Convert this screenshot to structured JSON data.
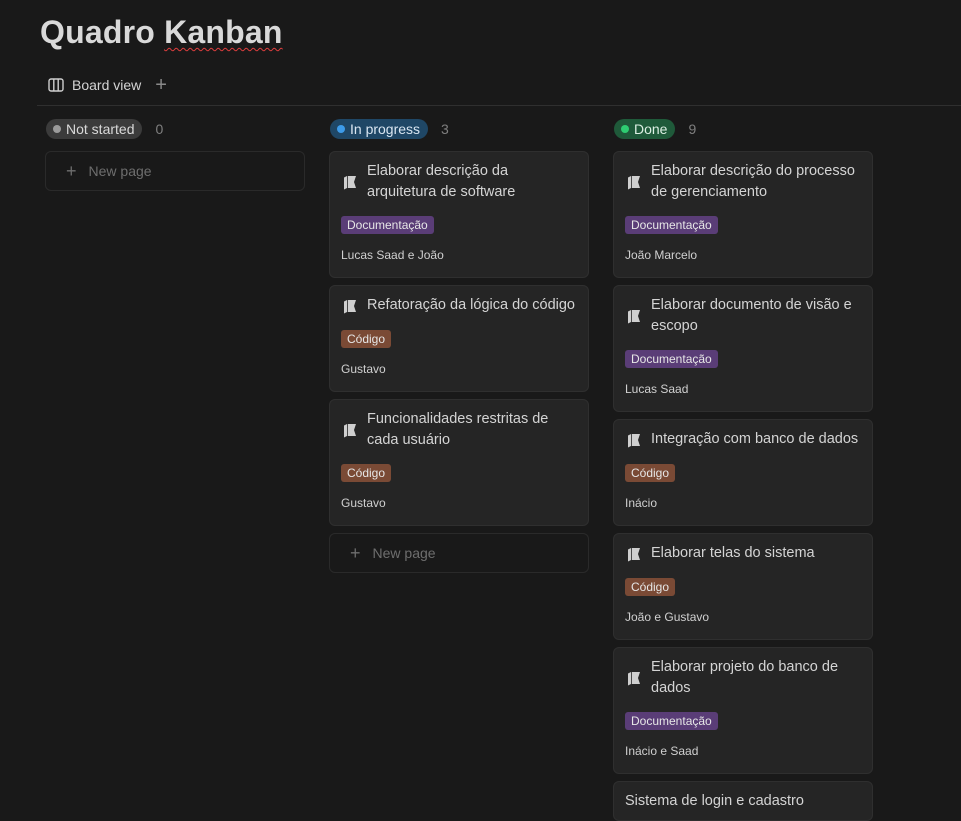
{
  "page": {
    "title_part1": "Quadro ",
    "title_part2": "Kanban"
  },
  "views": {
    "active_label": "Board view",
    "add_symbol": "+"
  },
  "colors": {
    "not_started_pill": "#3b3b3b",
    "not_started_dot": "#9b9b9b",
    "in_progress_pill": "#1f4766",
    "in_progress_dot": "#3d9be9",
    "done_pill": "#1f5a3a",
    "done_dot": "#2ecc71",
    "tag_documentacao": "#5a3d77",
    "tag_codigo": "#7a4a35"
  },
  "columns": [
    {
      "status": "Not started",
      "count": "0",
      "new_page_label": "New page",
      "cards": []
    },
    {
      "status": "In progress",
      "count": "3",
      "new_page_label": "New page",
      "cards": [
        {
          "title": "Elaborar descrição da arquitetura de software",
          "tag": "Documentação",
          "assignee": "Lucas Saad e João"
        },
        {
          "title": "Refatoração da lógica do código",
          "tag": "Código",
          "assignee": "Gustavo"
        },
        {
          "title": "Funcionalidades restritas de cada usuário",
          "tag": "Código",
          "assignee": "Gustavo"
        }
      ]
    },
    {
      "status": "Done",
      "count": "9",
      "cards": [
        {
          "title": "Elaborar descrição do processo de gerenciamento",
          "tag": "Documentação",
          "assignee": "João Marcelo"
        },
        {
          "title": "Elaborar documento de visão e escopo",
          "tag": "Documentação",
          "assignee": "Lucas Saad"
        },
        {
          "title": "Integração com banco de dados",
          "tag": "Código",
          "assignee": "Inácio"
        },
        {
          "title": "Elaborar telas do sistema",
          "tag": "Código",
          "assignee": "João e Gustavo"
        },
        {
          "title": "Elaborar projeto do banco de dados",
          "tag": "Documentação",
          "assignee": "Inácio e Saad"
        },
        {
          "title": "Sistema de login e cadastro"
        }
      ]
    }
  ]
}
